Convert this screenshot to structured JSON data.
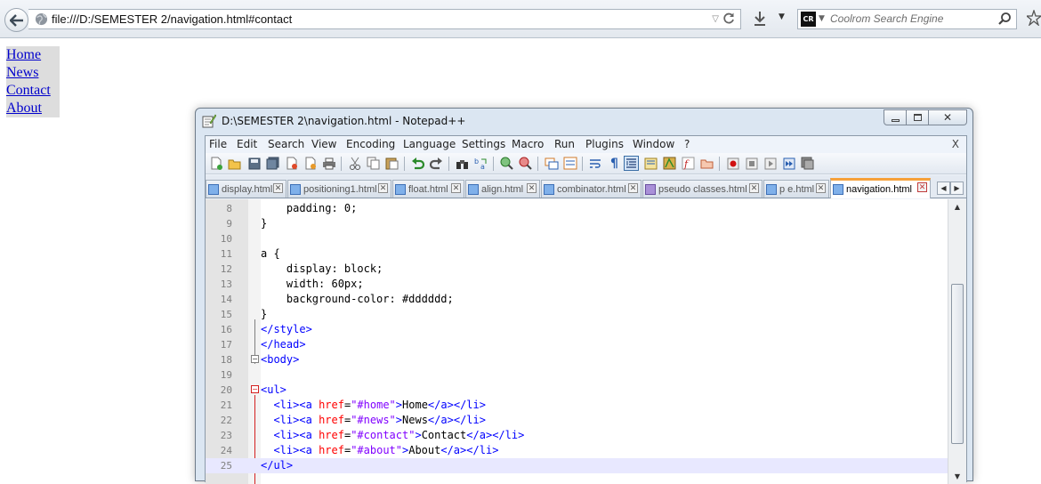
{
  "browser": {
    "url": "file:///D:/SEMESTER 2/navigation.html#contact",
    "search_placeholder": "Coolrom Search Engine",
    "search_engine_badge": "CR"
  },
  "page": {
    "nav_links": [
      "Home",
      "News",
      "Contact",
      "About"
    ]
  },
  "notepad": {
    "title": "D:\\SEMESTER 2\\navigation.html - Notepad++",
    "menu": [
      "File",
      "Edit",
      "Search",
      "View",
      "Encoding",
      "Language",
      "Settings",
      "Macro",
      "Run",
      "Plugins",
      "Window",
      "?"
    ],
    "menu_close": "X",
    "tabs": [
      {
        "label": "display.html",
        "active": false
      },
      {
        "label": "positioning1.html",
        "active": false
      },
      {
        "label": "float.html",
        "active": false
      },
      {
        "label": "align.html",
        "active": false
      },
      {
        "label": "combinator.html",
        "active": false
      },
      {
        "label": "pseudo classes.html",
        "active": false
      },
      {
        "label": "p e.html",
        "active": false
      },
      {
        "label": "navigation.html",
        "active": true
      }
    ],
    "code_lines": [
      {
        "num": "8",
        "text": "    padding: 0;"
      },
      {
        "num": "9",
        "text": "}"
      },
      {
        "num": "10",
        "text": ""
      },
      {
        "num": "11",
        "text": "a {"
      },
      {
        "num": "12",
        "text": "    display: block;"
      },
      {
        "num": "13",
        "text": "    width: 60px;"
      },
      {
        "num": "14",
        "text": "    background-color: #dddddd;"
      },
      {
        "num": "15",
        "text": "}"
      },
      {
        "num": "16",
        "text": "</style>"
      },
      {
        "num": "17",
        "text": "</head>"
      },
      {
        "num": "18",
        "text": "<body>"
      },
      {
        "num": "19",
        "text": ""
      },
      {
        "num": "20",
        "text": "<ul>"
      },
      {
        "num": "21",
        "text": "  <li><a href=\"#home\">Home</a></li>"
      },
      {
        "num": "22",
        "text": "  <li><a href=\"#news\">News</a></li>"
      },
      {
        "num": "23",
        "text": "  <li><a href=\"#contact\">Contact</a></li>"
      },
      {
        "num": "24",
        "text": "  <li><a href=\"#about\">About</a></li>"
      },
      {
        "num": "25",
        "text": "</ul>"
      }
    ],
    "current_line": "25"
  },
  "colors": {
    "link": "#0000cc",
    "link_bg": "#dddddd",
    "active_tab_accent": "#f6a13a",
    "html_tag": "#0000ff",
    "html_attr": "#ff0000",
    "html_value": "#8000ff"
  }
}
